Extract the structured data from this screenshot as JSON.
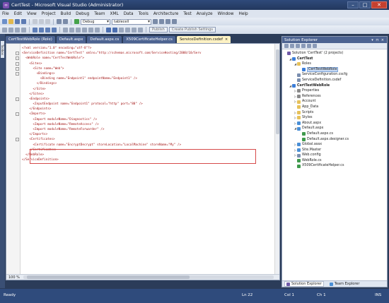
{
  "window": {
    "title": "CertTest - Microsoft Visual Studio (Administrator)",
    "controls": [
      "–",
      "□",
      "✕"
    ]
  },
  "menu": [
    "File",
    "Edit",
    "View",
    "Project",
    "Build",
    "Debug",
    "Team",
    "XML",
    "Data",
    "Tools",
    "Architecture",
    "Test",
    "Analyze",
    "Window",
    "Help"
  ],
  "toolbar": {
    "config_combo": "Debug",
    "search_combo": "tablecell",
    "publish_label": "Publish",
    "publish_settings": "Create Publish Settings"
  },
  "left_strip": {
    "toolbox_label": "Toolbox"
  },
  "tabs": [
    {
      "label": "CertTestWebRole (Role)",
      "active": false
    },
    {
      "label": "Default.aspx",
      "active": false
    },
    {
      "label": "Default.aspx.cs",
      "active": false
    },
    {
      "label": "X509CertificateHelper.cs",
      "active": false
    },
    {
      "label": "ServiceDefinition.csdef",
      "active": true,
      "close": "×"
    }
  ],
  "code_lines": [
    "<?xml version=\"1.0\" encoding=\"utf-8\"?>",
    "<ServiceDefinition name=\"CertTest\" xmlns=\"http://schemas.microsoft.com/ServiceHosting/2008/10/Serv",
    "  <WebRole name=\"CertTestWebRole\">",
    "    <Sites>",
    "      <Site name=\"Web\">",
    "        <Bindings>",
    "          <Binding name=\"Endpoint1\" endpointName=\"Endpoint1\" />",
    "        </Bindings>",
    "      </Site>",
    "    </Sites>",
    "    <Endpoints>",
    "      <InputEndpoint name=\"Endpoint1\" protocol=\"http\" port=\"80\" />",
    "    </Endpoints>",
    "    <Imports>",
    "      <Import moduleName=\"Diagnostics\" />",
    "      <Import moduleName=\"RemoteAccess\" />",
    "      <Import moduleName=\"RemoteForwarder\" />",
    "    </Imports>",
    "    <Certificates>",
    "      <Certificate name=\"EncryptDecrypt\" storeLocation=\"LocalMachine\" storeName=\"My\" />",
    "    </Certificates>",
    "  </WebRole>",
    "</ServiceDefinition>"
  ],
  "editor_footer": {
    "zoom": "100 %"
  },
  "solution_explorer": {
    "title": "Solution Explorer",
    "pin_controls": "▾ ⊓ ×",
    "tree": [
      {
        "label": "Solution 'CertTest' (2 projects)",
        "indent": 0,
        "exp": "",
        "icon": "solution",
        "color": "#6f5aa8"
      },
      {
        "label": "CertTest",
        "indent": 1,
        "exp": "◢",
        "icon": "cloud-project",
        "color": "#3b7dd8",
        "bold": true
      },
      {
        "label": "Roles",
        "indent": 2,
        "exp": "◢",
        "icon": "folder",
        "color": "#e6c15a"
      },
      {
        "label": "CertTestWebRole",
        "indent": 3,
        "exp": "",
        "icon": "role",
        "color": "#3b7dd8",
        "selected": true
      },
      {
        "label": "ServiceConfiguration.cscfg",
        "indent": 2,
        "exp": "",
        "icon": "config-file",
        "color": "#7b8fb0"
      },
      {
        "label": "ServiceDefinition.csdef",
        "indent": 2,
        "exp": "",
        "icon": "def-file",
        "color": "#7b8fb0"
      },
      {
        "label": "CertTestWebRole",
        "indent": 1,
        "exp": "◢",
        "icon": "web-project",
        "color": "#3b7dd8",
        "bold": true
      },
      {
        "label": "Properties",
        "indent": 2,
        "exp": "▷",
        "icon": "properties",
        "color": "#8a8a8a"
      },
      {
        "label": "References",
        "indent": 2,
        "exp": "▷",
        "icon": "references",
        "color": "#8a8a8a"
      },
      {
        "label": "Account",
        "indent": 2,
        "exp": "▷",
        "icon": "folder",
        "color": "#e6c15a"
      },
      {
        "label": "App_Data",
        "indent": 2,
        "exp": "",
        "icon": "folder",
        "color": "#e6c15a"
      },
      {
        "label": "Scripts",
        "indent": 2,
        "exp": "▷",
        "icon": "folder",
        "color": "#e6c15a"
      },
      {
        "label": "Styles",
        "indent": 2,
        "exp": "▷",
        "icon": "folder",
        "color": "#e6c15a"
      },
      {
        "label": "About.aspx",
        "indent": 2,
        "exp": "▷",
        "icon": "aspx-file",
        "color": "#4a8fd6"
      },
      {
        "label": "Default.aspx",
        "indent": 2,
        "exp": "◢",
        "icon": "aspx-file",
        "color": "#4a8fd6"
      },
      {
        "label": "Default.aspx.cs",
        "indent": 3,
        "exp": "",
        "icon": "cs-file",
        "color": "#3f9a4d"
      },
      {
        "label": "Default.aspx.designer.cs",
        "indent": 3,
        "exp": "",
        "icon": "cs-file",
        "color": "#3f9a4d"
      },
      {
        "label": "Global.asax",
        "indent": 2,
        "exp": "▷",
        "icon": "asax-file",
        "color": "#4a8fd6"
      },
      {
        "label": "Site.Master",
        "indent": 2,
        "exp": "▷",
        "icon": "master-file",
        "color": "#4a8fd6"
      },
      {
        "label": "Web.config",
        "indent": 2,
        "exp": "▷",
        "icon": "config-file",
        "color": "#7b8fb0"
      },
      {
        "label": "WebRole.cs",
        "indent": 2,
        "exp": "",
        "icon": "cs-file",
        "color": "#3f9a4d"
      },
      {
        "label": "X509CertificateHelper.cs",
        "indent": 2,
        "exp": "",
        "icon": "cs-file",
        "color": "#3f9a4d"
      }
    ],
    "bottom_tabs": [
      "Solution Explorer",
      "Team Explorer"
    ]
  },
  "status": {
    "ready": "Ready",
    "ln": "Ln 22",
    "col": "Col 1",
    "ch": "Ch 1",
    "mode": "INS"
  },
  "colors": {
    "highlight_box": "#d64a4a",
    "chrome": "#2f4b7c"
  }
}
